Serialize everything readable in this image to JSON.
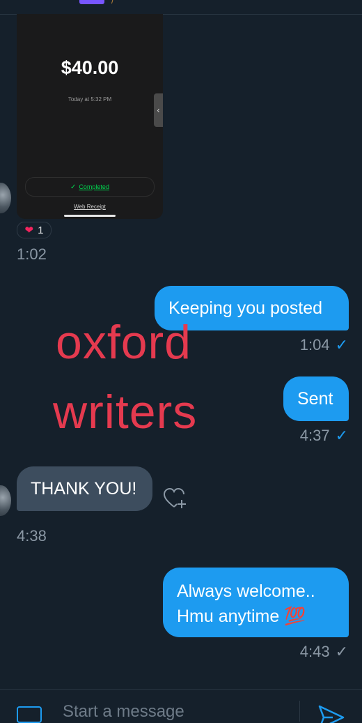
{
  "payment_card": {
    "amount": "$40.00",
    "date": "Today at 5:32 PM",
    "status": "Completed",
    "web_receipt": "Web Receipt"
  },
  "reaction": {
    "emoji": "heart",
    "count": "1"
  },
  "messages": [
    {
      "direction": "received",
      "time": "1:02"
    },
    {
      "direction": "sent",
      "text": "Keeping you posted",
      "time": "1:04",
      "status": "read"
    },
    {
      "direction": "sent",
      "text": "Sent",
      "time": "4:37",
      "status": "read"
    },
    {
      "direction": "received",
      "text": "THANK YOU!",
      "time": "4:38"
    },
    {
      "direction": "sent",
      "line1": "Always welcome..",
      "line2": "Hmu anytime 💯",
      "time": "4:43",
      "status": "delivered"
    }
  ],
  "watermark": {
    "line1": "oxford",
    "line2": "writers"
  },
  "composer": {
    "placeholder": "Start a message"
  },
  "colors": {
    "background": "#15202b",
    "sent_bubble": "#1d9bf0",
    "received_bubble": "#3d4d5e",
    "watermark": "#e53a4f",
    "cash_green": "#00d64f"
  }
}
